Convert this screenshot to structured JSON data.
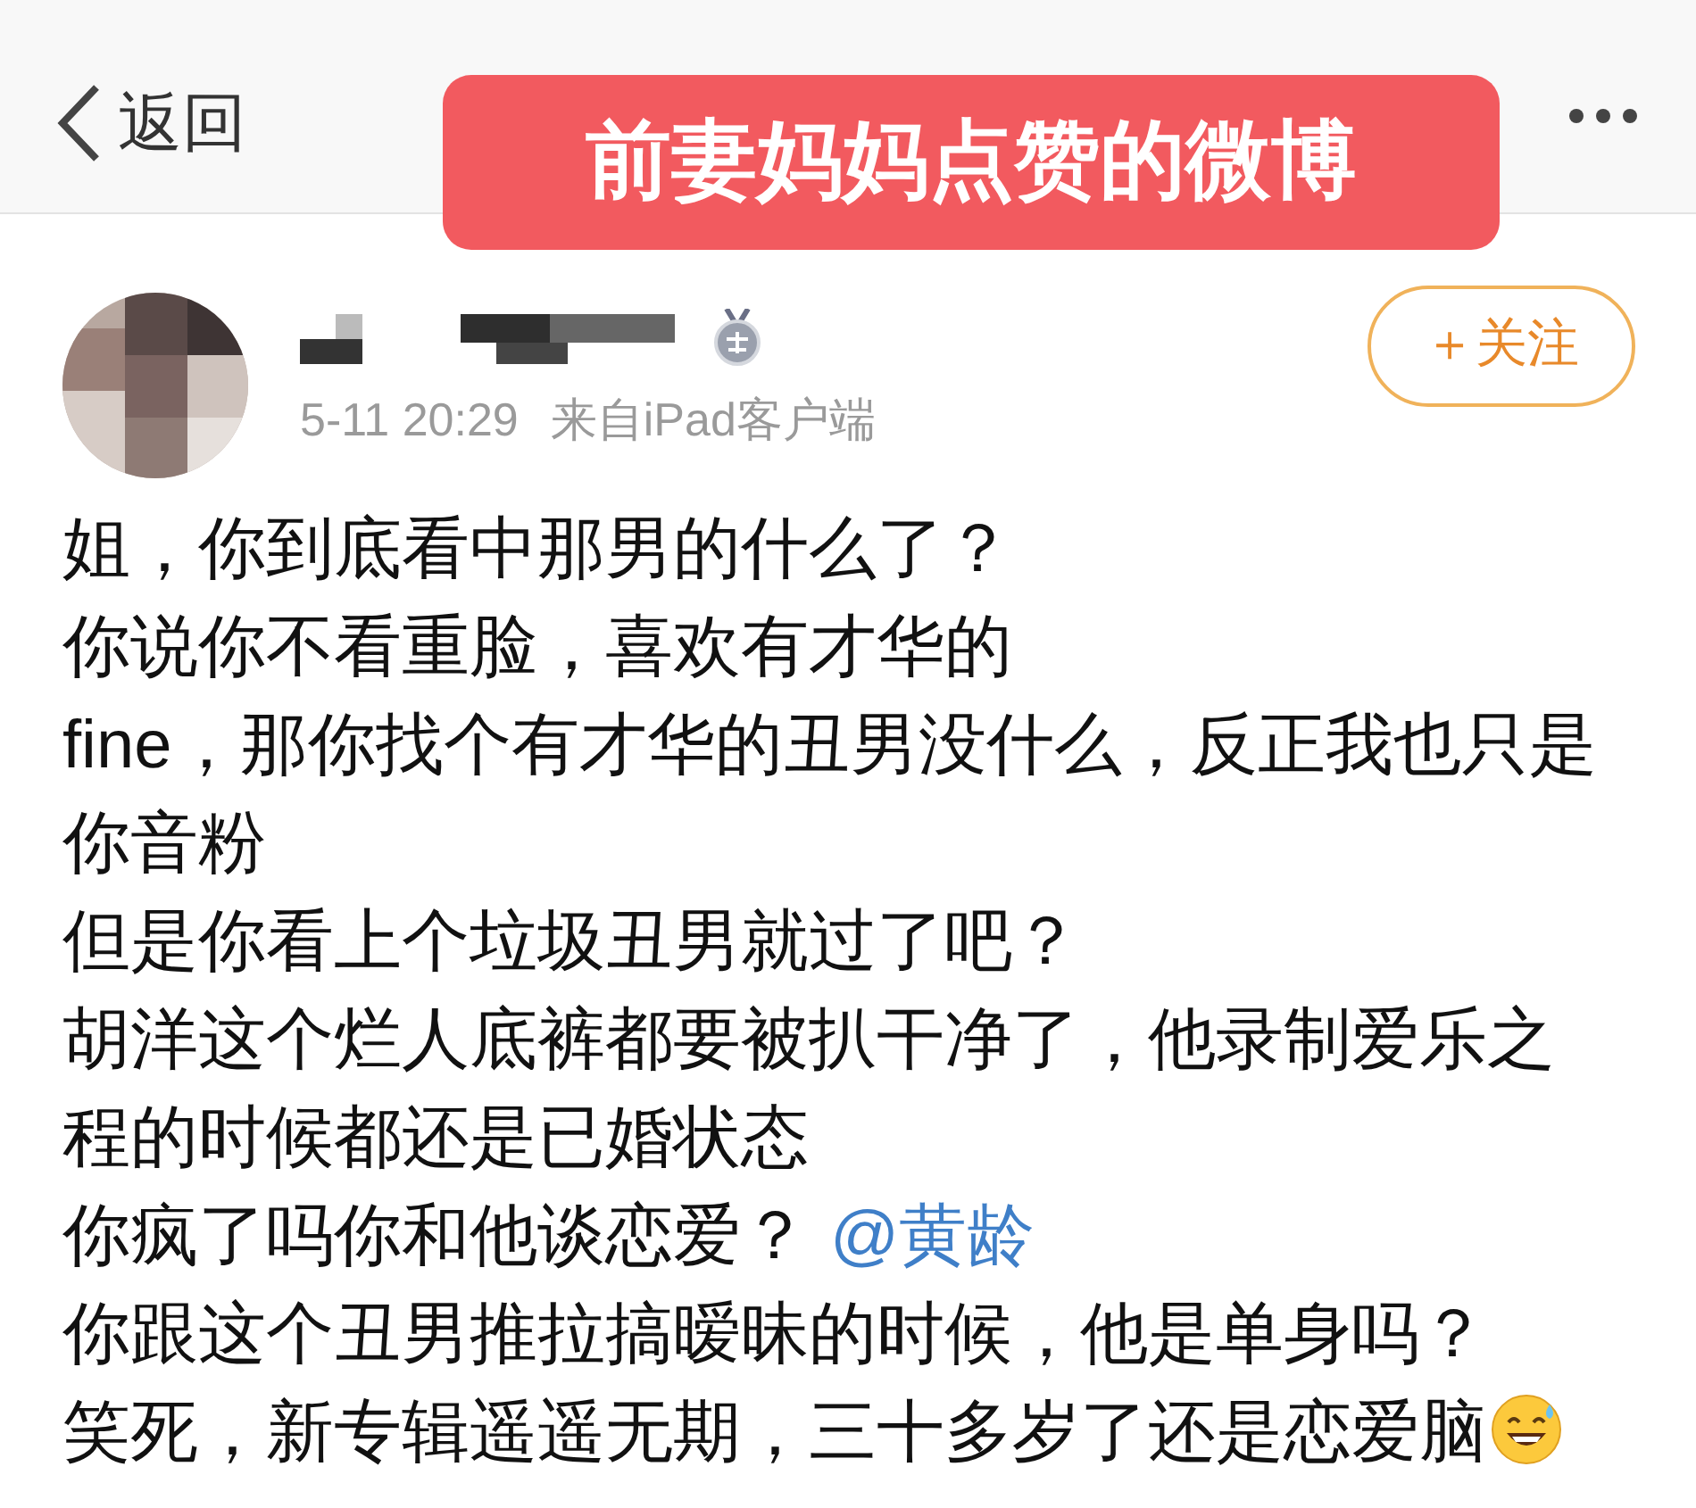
{
  "nav": {
    "back_label": "返回"
  },
  "overlay_banner": "前妻妈妈点赞的微博",
  "post": {
    "time": "5-11 20:29",
    "source": "来自iPad客户端",
    "follow_label": "＋关注",
    "paragraphs": [
      {
        "text": "姐，你到底看中那男的什么了？"
      },
      {
        "text": "你说你不看重脸，喜欢有才华的"
      },
      {
        "text": "fine，那你找个有才华的丑男没什么，反正我也只是你音粉"
      },
      {
        "text": "但是你看上个垃圾丑男就过了吧？"
      },
      {
        "text": "胡洋这个烂人底裤都要被扒干净了，他录制爱乐之程的时候都还是已婚状态"
      },
      {
        "text": "你疯了吗你和他谈恋爱？",
        "mention": "@黄龄"
      },
      {
        "text": "你跟这个丑男推拉搞暧昧的时候，他是单身吗？"
      },
      {
        "text": "笑死，新专辑遥遥无期，三十多岁了还是恋爱脑",
        "emoji": true
      }
    ]
  }
}
